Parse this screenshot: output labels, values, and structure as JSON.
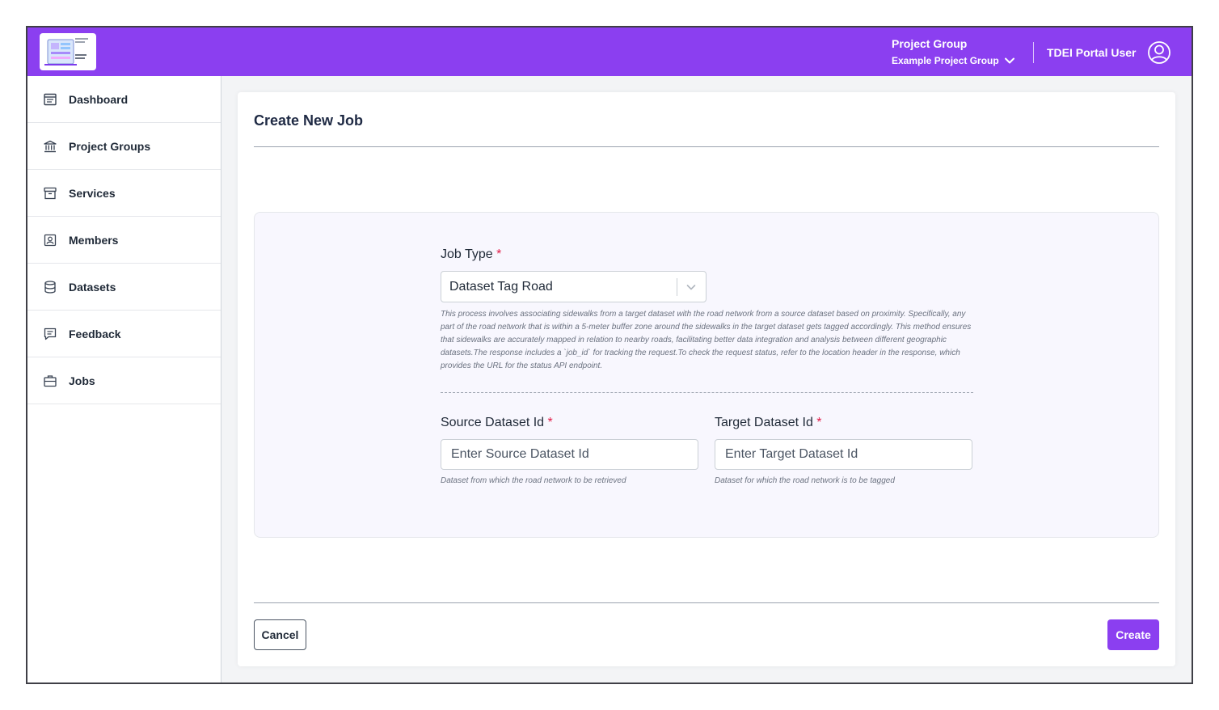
{
  "header": {
    "project_group_label": "Project Group",
    "project_group_value": "Example Project Group",
    "user_name": "TDEI Portal User",
    "brand_color": "#8b3ff0"
  },
  "sidebar": {
    "items": [
      {
        "label": "Dashboard",
        "icon": "dashboard-icon"
      },
      {
        "label": "Project Groups",
        "icon": "bank-icon"
      },
      {
        "label": "Services",
        "icon": "archive-icon"
      },
      {
        "label": "Members",
        "icon": "member-badge-icon"
      },
      {
        "label": "Datasets",
        "icon": "database-icon"
      },
      {
        "label": "Feedback",
        "icon": "feedback-icon"
      },
      {
        "label": "Jobs",
        "icon": "briefcase-icon"
      }
    ]
  },
  "main": {
    "title": "Create New Job",
    "job_type_label": "Job Type",
    "required_marker": "*",
    "job_type_value": "Dataset Tag Road",
    "job_type_description": "This process involves associating sidewalks from a target dataset with the road network from a source dataset based on proximity. Specifically, any part of the road network that is within a 5-meter buffer zone around the sidewalks in the target dataset gets tagged accordingly. This method ensures that sidewalks are accurately mapped in relation to nearby roads, facilitating better data integration and analysis between different geographic datasets.The response includes a `job_id` for tracking the request.To check the request status, refer to the location header in the response, which provides the URL for the status API endpoint.",
    "source_label": "Source Dataset Id",
    "source_placeholder": "Enter Source Dataset Id",
    "source_value": "",
    "source_hint": "Dataset from which the road network to be retrieved",
    "target_label": "Target Dataset Id",
    "target_placeholder": "Enter Target Dataset Id",
    "target_value": "",
    "target_hint": "Dataset for which the road network is to be tagged",
    "cancel_label": "Cancel",
    "create_label": "Create"
  }
}
